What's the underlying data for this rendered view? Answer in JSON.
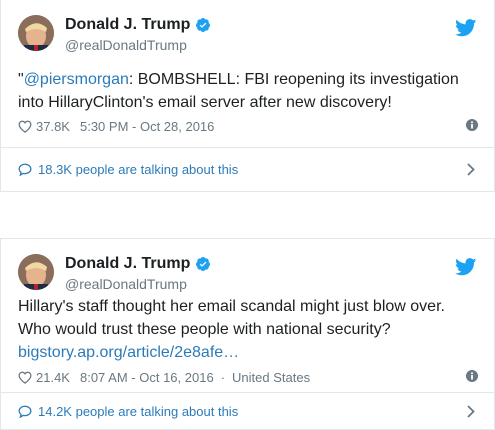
{
  "tweets": [
    {
      "name": "Donald J. Trump",
      "handle": "@realDonaldTrump",
      "text_prefix": "\"",
      "text_mention": "@piersmorgan",
      "text_body": ": BOMBSHELL: FBI reopening its investigation into HillaryClinton's email server after new discovery!",
      "likes": "37.8K",
      "timestamp": "5:30 PM - Oct 28, 2016",
      "location": "",
      "talking": "18.3K people are talking about this"
    },
    {
      "name": "Donald J. Trump",
      "handle": "@realDonaldTrump",
      "text_line1": "Hillary's staff thought her email scandal might just blow over.",
      "text_line2": "Who would trust these people with national security?",
      "link": "bigstory.ap.org/article/2e8afe…",
      "likes": "21.4K",
      "timestamp": "8:07 AM - Oct 16, 2016",
      "location": "United States",
      "talking": "14.2K people are talking about this"
    }
  ],
  "icons": {
    "verified": "verified-badge-icon",
    "bird": "twitter-bird-icon",
    "heart": "heart-icon",
    "info": "info-icon",
    "bubble": "speech-bubble-icon",
    "chevron": "chevron-right-icon"
  },
  "colors": {
    "accent": "#1da1f2",
    "link": "#2b7bb9",
    "muted": "#697882",
    "border": "#e1e8ed"
  }
}
